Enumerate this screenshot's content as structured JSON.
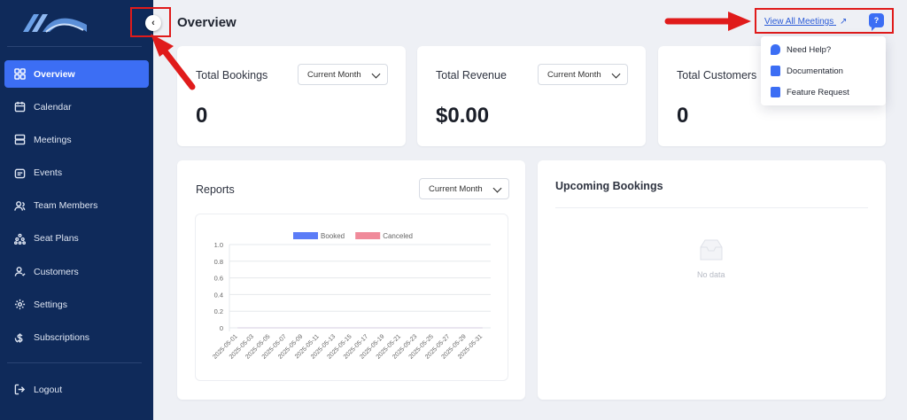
{
  "sidebar": {
    "items": [
      {
        "label": "Overview",
        "icon": "grid-icon",
        "active": true
      },
      {
        "label": "Calendar",
        "icon": "calendar-icon"
      },
      {
        "label": "Meetings",
        "icon": "meetings-icon"
      },
      {
        "label": "Events",
        "icon": "events-icon"
      },
      {
        "label": "Team Members",
        "icon": "team-icon"
      },
      {
        "label": "Seat Plans",
        "icon": "seat-icon"
      },
      {
        "label": "Customers",
        "icon": "customers-icon"
      },
      {
        "label": "Settings",
        "icon": "gear-icon"
      },
      {
        "label": "Subscriptions",
        "icon": "dollar-icon"
      }
    ],
    "logout_label": "Logout"
  },
  "header": {
    "title": "Overview",
    "view_all_label": "View All Meetings",
    "help_glyph": "?"
  },
  "help_menu": {
    "items": [
      "Need Help?",
      "Documentation",
      "Feature Request"
    ]
  },
  "stats": [
    {
      "title": "Total Bookings",
      "value": "0",
      "filter": "Current Month"
    },
    {
      "title": "Total Revenue",
      "value": "$0.00",
      "filter": "Current Month"
    },
    {
      "title": "Total Customers",
      "value": "0"
    }
  ],
  "reports": {
    "title": "Reports",
    "filter": "Current Month"
  },
  "upcoming": {
    "title": "Upcoming Bookings",
    "empty_text": "No data"
  },
  "colors": {
    "sidebar_bg": "#0f2a5a",
    "accent": "#3c6ef4",
    "booked": "#5b7cf7",
    "canceled": "#f08a9a",
    "annotation_red": "#e01b1b"
  },
  "chart_data": {
    "type": "line",
    "series": [
      {
        "name": "Booked",
        "values": [
          0,
          0,
          0,
          0,
          0,
          0,
          0,
          0,
          0,
          0,
          0,
          0,
          0,
          0,
          0,
          0
        ]
      },
      {
        "name": "Canceled",
        "values": [
          0,
          0,
          0,
          0,
          0,
          0,
          0,
          0,
          0,
          0,
          0,
          0,
          0,
          0,
          0,
          0
        ]
      }
    ],
    "categories": [
      "2025-05-01",
      "2025-05-03",
      "2025-05-05",
      "2025-05-07",
      "2025-05-09",
      "2025-05-11",
      "2025-05-13",
      "2025-05-15",
      "2025-05-17",
      "2025-05-19",
      "2025-05-21",
      "2025-05-23",
      "2025-05-25",
      "2025-05-27",
      "2025-05-29",
      "2025-05-31"
    ],
    "y_ticks": [
      "0",
      "0.2",
      "0.4",
      "0.6",
      "0.8",
      "1.0"
    ],
    "ylim": [
      0,
      1.0
    ],
    "legend": "top",
    "grid": true
  }
}
